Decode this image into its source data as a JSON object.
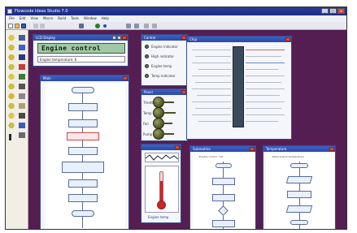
{
  "app": {
    "title": "Flowcode Ideas Studio 7.0"
  },
  "menu": [
    "File",
    "Edit",
    "View",
    "Macro",
    "Build",
    "Tools",
    "Window",
    "Help"
  ],
  "lcd_window": {
    "title": "LCD Display",
    "text": "Engine control",
    "field": "Engine temperature: 6"
  },
  "flowchart_main": {
    "title": "Main"
  },
  "io_panel": {
    "title": "Control",
    "items": [
      "Engine indicator",
      "High indicator",
      "Engine temp",
      "Temp indicator"
    ]
  },
  "knobs_panel": {
    "title": "Panel",
    "items": [
      "Throttle",
      "Temp",
      "Fan",
      "Pump"
    ]
  },
  "thermometer": {
    "label": "Engine temp"
  },
  "chip_window": {
    "title": "Chip"
  },
  "sub_flow_1": {
    "title": "Subroutine",
    "caption": "Engine control - Init"
  },
  "sub_flow_2": {
    "title": "Temperature",
    "caption": "Read engine temperature"
  },
  "colors": {
    "workspace": "#551e52",
    "titlebar": "#2a3a9a",
    "accent_red": "#c82828",
    "knob": "#6a7030"
  }
}
